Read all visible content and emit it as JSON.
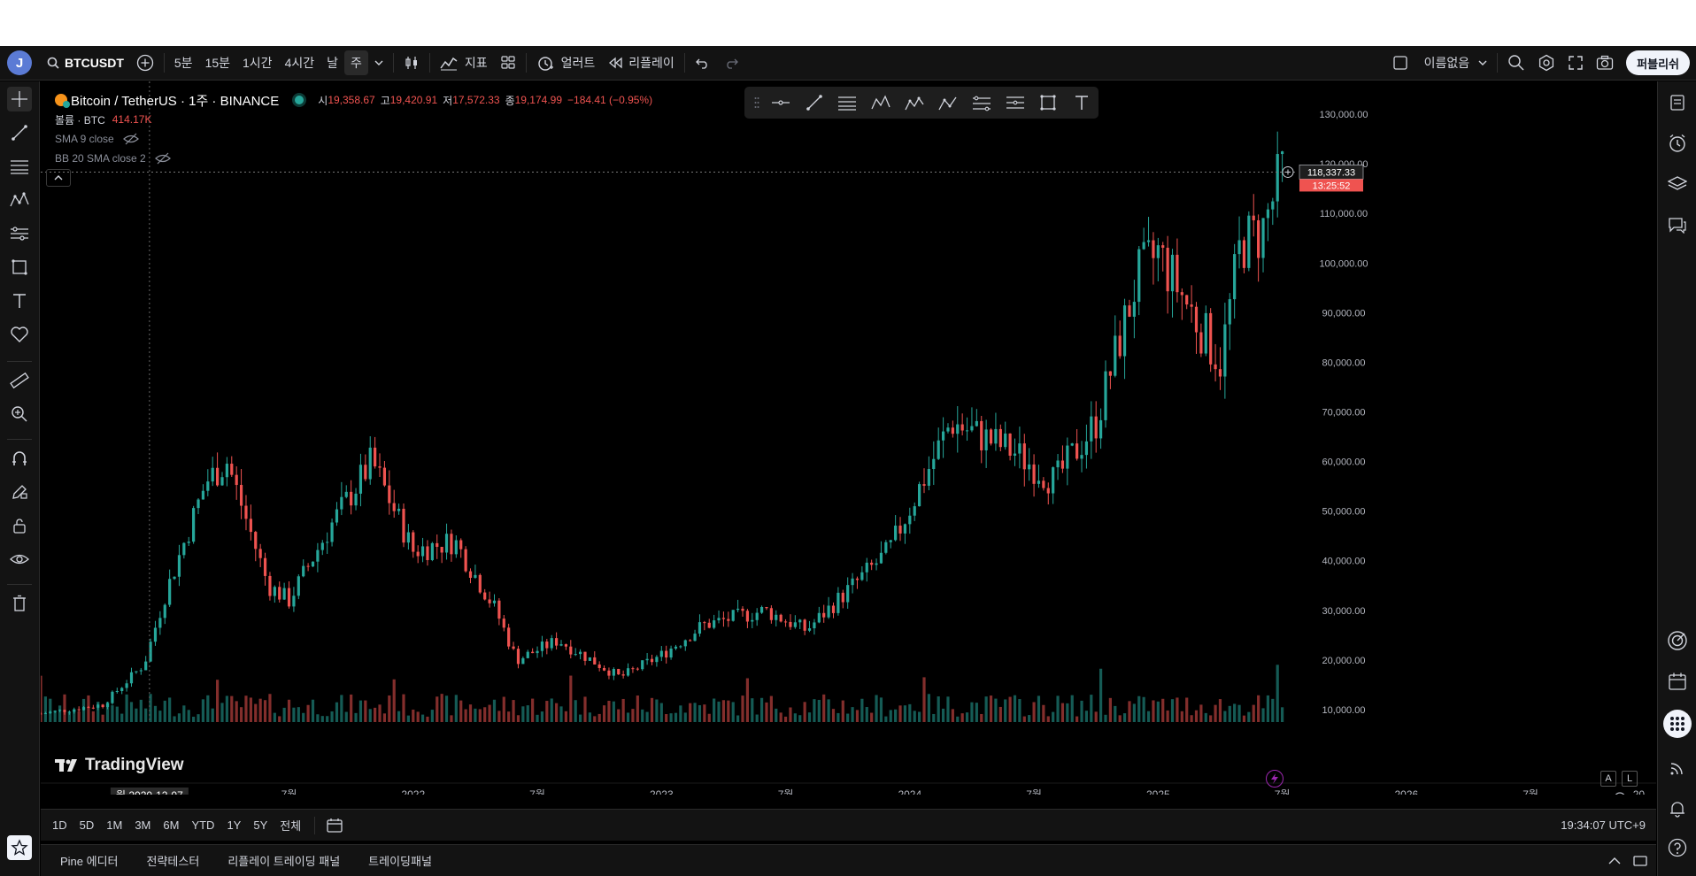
{
  "topbar": {
    "avatar_letter": "J",
    "symbol": "BTCUSDT",
    "timeframes": [
      "5분",
      "15분",
      "1시간",
      "4시간",
      "날",
      "주"
    ],
    "active_timeframe": "주",
    "indicators_label": "지표",
    "alert_label": "얼러트",
    "replay_label": "리플레이",
    "layout_name": "이름없음",
    "publish_label": "퍼블리쉬"
  },
  "legend": {
    "title": "Bitcoin / TetherUS · 1주 · BINANCE",
    "open_label": "시",
    "open": "19,358.67",
    "high_label": "고",
    "high": "19,420.91",
    "low_label": "저",
    "low": "17,572.33",
    "close_label": "종",
    "close": "19,174.99",
    "change": "−184.41 (−0.95%)",
    "volume_label": "볼륨 · BTC",
    "volume": "414.17K",
    "sma_label": "SMA 9 close",
    "bb_label": "BB 20 SMA close 2"
  },
  "price_axis": {
    "labels": [
      "130,000.00",
      "120,000.00",
      "110,000.00",
      "100,000.00",
      "90,000.00",
      "80,000.00",
      "70,000.00",
      "60,000.00",
      "50,000.00",
      "40,000.00",
      "30,000.00",
      "20,000.00",
      "10,000.00"
    ],
    "current_price": "118,337.33",
    "countdown": "13:25:52",
    "auto_label": "A",
    "log_label": "L"
  },
  "time_axis": {
    "labels": [
      "7월",
      "2022",
      "7월",
      "2023",
      "7월",
      "2024",
      "7월",
      "2025",
      "7월",
      "2026",
      "7월",
      "20"
    ],
    "crosshair_date": "월 2020-12-07"
  },
  "watermark": "TradingView",
  "periods": [
    "1D",
    "5D",
    "1M",
    "3M",
    "6M",
    "YTD",
    "1Y",
    "5Y",
    "전체"
  ],
  "clock": "19:34:07 UTC+9",
  "panels": [
    "Pine 에디터",
    "전략테스터",
    "리플레이 트레이딩 패널",
    "트레이딩패널"
  ],
  "colors": {
    "up": "#26a69a",
    "down": "#ef5350",
    "background": "#000000",
    "accent": "#2962ff"
  },
  "chart_data": {
    "type": "candlestick",
    "symbol": "BTCUSDT",
    "interval": "1W",
    "ylim": [
      5000,
      135000
    ],
    "x_range": [
      "2020-07",
      "2026-12"
    ],
    "series": [
      {
        "name": "Bitcoin / TetherUS",
        "x": [
          "2020-07",
          "2020-10",
          "2020-12",
          "2021-01",
          "2021-03",
          "2021-04",
          "2021-06",
          "2021-07",
          "2021-09",
          "2021-11",
          "2022-01",
          "2022-03",
          "2022-05",
          "2022-06",
          "2022-08",
          "2022-11",
          "2023-01",
          "2023-03",
          "2023-06",
          "2023-08",
          "2023-10",
          "2023-12",
          "2024-03",
          "2024-06",
          "2024-08",
          "2024-10",
          "2024-12",
          "2025-01",
          "2025-04",
          "2025-05",
          "2025-06",
          "2025-07"
        ],
        "close": [
          9200,
          11000,
          19200,
          33000,
          56000,
          60000,
          35000,
          32000,
          47000,
          60000,
          42000,
          44000,
          30000,
          20000,
          24000,
          16500,
          21000,
          27000,
          30000,
          26000,
          34000,
          42000,
          68000,
          62000,
          56000,
          68000,
          97000,
          102000,
          80000,
          104000,
          106000,
          118337
        ]
      }
    ],
    "volume_series_visible": true
  }
}
